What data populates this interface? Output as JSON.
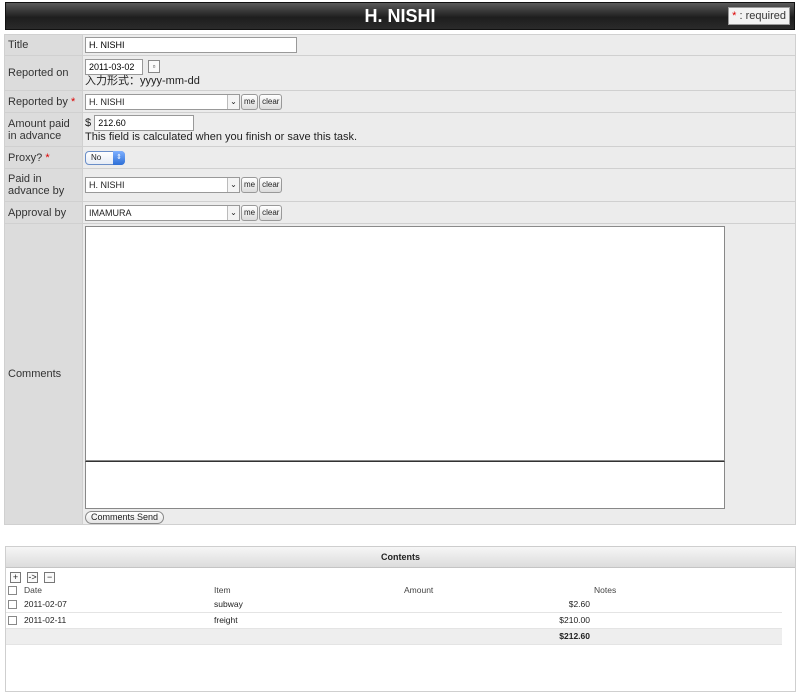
{
  "header": {
    "title": "H. NISHI",
    "required_star": "*",
    "required_text": ": required"
  },
  "form": {
    "title": {
      "label": "Title",
      "value": "H. NISHI"
    },
    "reported_on": {
      "label": "Reported on",
      "value": "2011-03-02",
      "hint": "入力形式：yyyy-mm-dd"
    },
    "reported_by": {
      "label": "Reported by",
      "star": "*",
      "value": "H. NISHI",
      "me": "me",
      "clear": "clear"
    },
    "amount_paid": {
      "label": "Amount paid in advance",
      "currency": "$",
      "value": "212.60",
      "hint": "This field is calculated when you finish or save this task."
    },
    "proxy": {
      "label": "Proxy?",
      "star": "*",
      "value": "No"
    },
    "paid_by": {
      "label": "Paid in advance by",
      "value": "H. NISHI",
      "me": "me",
      "clear": "clear"
    },
    "approval_by": {
      "label": "Approval by",
      "value": "IMAMURA",
      "me": "me",
      "clear": "clear"
    },
    "comments": {
      "label": "Comments",
      "send_label": "Comments Send"
    }
  },
  "contents": {
    "title": "Contents",
    "toolbar": {
      "add": "+",
      "move": "->",
      "remove": "−"
    },
    "columns": [
      "Date",
      "Item",
      "Amount",
      "Notes"
    ],
    "rows": [
      {
        "date": "2011-02-07",
        "item": "subway",
        "amount": "$2.60",
        "notes": ""
      },
      {
        "date": "2011-02-11",
        "item": "freight",
        "amount": "$210.00",
        "notes": ""
      }
    ],
    "total": "$212.60"
  },
  "colors": {
    "titlebar": "#2a2a2a",
    "label_bg": "#dcdcdc",
    "value_bg": "#ececec",
    "required": "#dd0000"
  }
}
